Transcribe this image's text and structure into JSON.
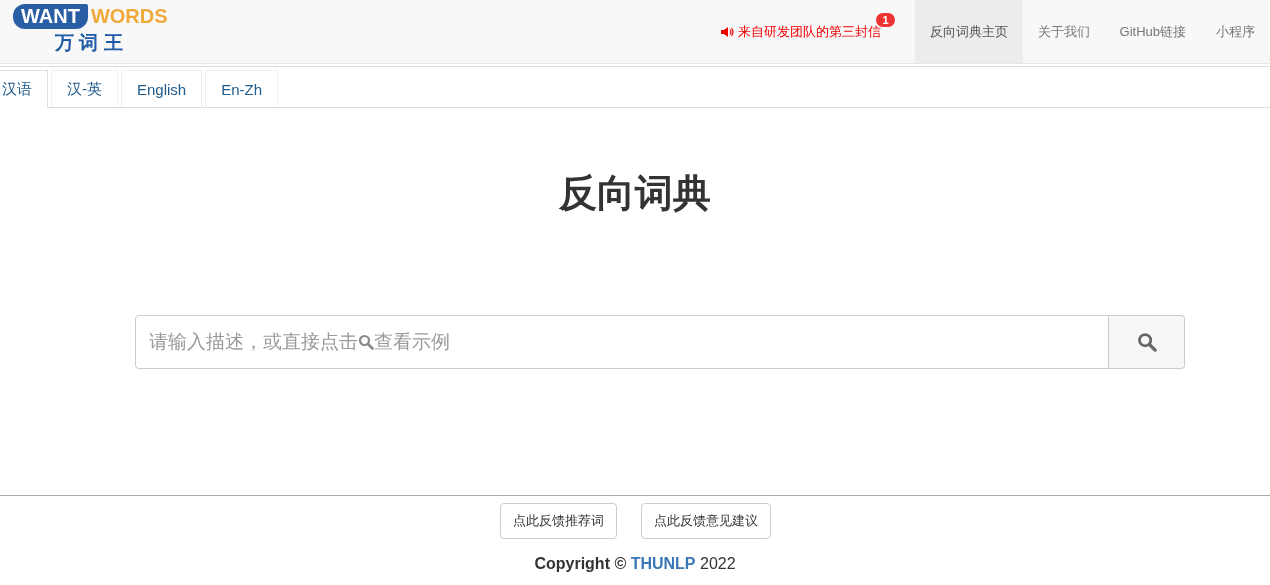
{
  "logo": {
    "word_1": "WANT",
    "word_2": "WORDS",
    "subtitle": "万 词 王"
  },
  "notice": {
    "text": "来自研发团队的第三封信",
    "badge": "1"
  },
  "nav": [
    {
      "label": "反向词典主页",
      "selected": true
    },
    {
      "label": "关于我们",
      "selected": false
    },
    {
      "label": "GitHub链接",
      "selected": false
    },
    {
      "label": "小程序",
      "selected": false
    }
  ],
  "tabs": [
    {
      "label": "汉语",
      "selected": true
    },
    {
      "label": "汉-英",
      "selected": false
    },
    {
      "label": "English",
      "selected": false
    },
    {
      "label": "En-Zh",
      "selected": false
    }
  ],
  "title": "反向词典",
  "search": {
    "placeholder": [
      "请输入描述，或直接点击",
      "查看示例"
    ]
  },
  "feedback_buttons": [
    "点此反馈推荐词",
    "点此反馈意见建议"
  ],
  "footer": {
    "copyright": "Copyright ©",
    "link": "THUNLP",
    "year": "2022"
  }
}
